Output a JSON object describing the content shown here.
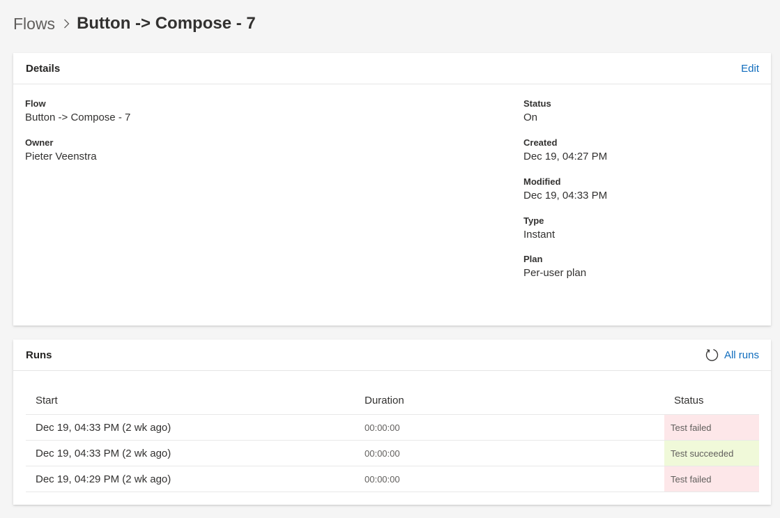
{
  "breadcrumb": {
    "root": "Flows",
    "current": "Button -> Compose - 7"
  },
  "details": {
    "title": "Details",
    "edit_label": "Edit",
    "flow": {
      "label": "Flow",
      "value": "Button -> Compose - 7"
    },
    "owner": {
      "label": "Owner",
      "value": "Pieter Veenstra"
    },
    "status": {
      "label": "Status",
      "value": "On"
    },
    "created": {
      "label": "Created",
      "value": "Dec 19, 04:27 PM"
    },
    "modified": {
      "label": "Modified",
      "value": "Dec 19, 04:33 PM"
    },
    "type": {
      "label": "Type",
      "value": "Instant"
    },
    "plan": {
      "label": "Plan",
      "value": "Per-user plan"
    }
  },
  "runs": {
    "title": "Runs",
    "all_runs_label": "All runs",
    "refresh_icon": "refresh-icon",
    "columns": {
      "start": "Start",
      "duration": "Duration",
      "status": "Status"
    },
    "rows": [
      {
        "start": "Dec 19, 04:33 PM (2 wk ago)",
        "duration": "00:00:00",
        "status": "Test failed"
      },
      {
        "start": "Dec 19, 04:33 PM (2 wk ago)",
        "duration": "00:00:00",
        "status": "Test succeeded"
      },
      {
        "start": "Dec 19, 04:29 PM (2 wk ago)",
        "duration": "00:00:00",
        "status": "Test failed"
      }
    ]
  },
  "colors": {
    "link": "#0f6cbd",
    "status_failed_bg": "#fde7e9",
    "status_succeeded_bg": "#f0f9d9"
  }
}
